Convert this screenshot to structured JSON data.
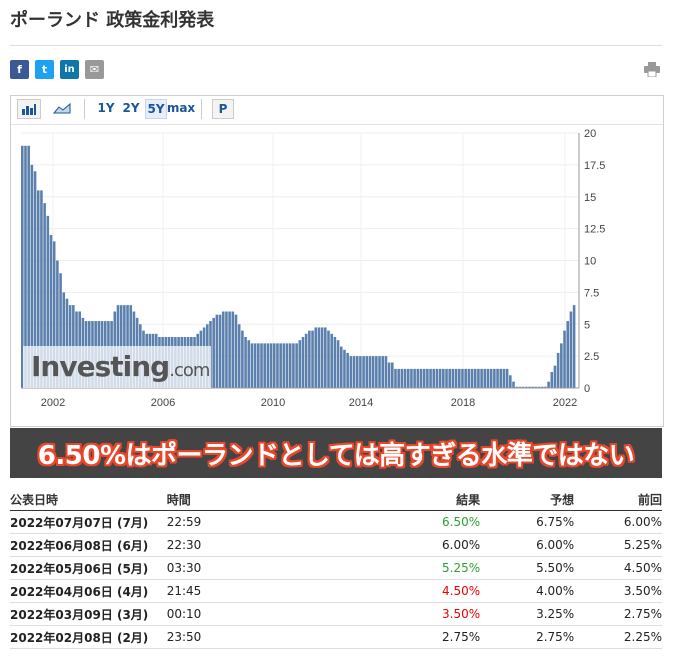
{
  "page": {
    "title": "ポーランド 政策金利発表"
  },
  "share": {
    "facebook": "f",
    "twitter": "t",
    "linkedin": "in",
    "email": "✉"
  },
  "toolbar": {
    "ranges": [
      "1Y",
      "2Y",
      "5Y",
      "max"
    ],
    "active_range": "5Y",
    "p_button": "P"
  },
  "chart_data": {
    "type": "bar",
    "title": "",
    "x_ticks": [
      "2002",
      "2006",
      "2010",
      "2014",
      "2018",
      "2022"
    ],
    "y_ticks": [
      "20",
      "17.5",
      "15",
      "12.5",
      "10",
      "7.5",
      "5",
      "2.5",
      "0"
    ],
    "ylim": [
      0,
      20
    ],
    "grid": true,
    "watermark": "Investing",
    "watermark_suffix": ".com",
    "color": "#5b80ad",
    "values": [
      19,
      19,
      19,
      17.5,
      17,
      15.5,
      15.5,
      14.5,
      13.5,
      12,
      11.5,
      10,
      9,
      7.5,
      7,
      6.5,
      6.5,
      6,
      6,
      5.5,
      5.25,
      5.25,
      5.25,
      5.25,
      5.25,
      5.25,
      5.25,
      5.25,
      5.25,
      6,
      6.5,
      6.5,
      6.5,
      6.5,
      6.5,
      6,
      5.5,
      5,
      4.5,
      4.25,
      4.25,
      4.25,
      4.25,
      4,
      4,
      4,
      4,
      4,
      4,
      4,
      4,
      4,
      4,
      4,
      4,
      4.25,
      4.5,
      4.75,
      5,
      5.25,
      5.5,
      5.75,
      5.75,
      6,
      6,
      6,
      6,
      5.75,
      5,
      4.5,
      4,
      3.75,
      3.5,
      3.5,
      3.5,
      3.5,
      3.5,
      3.5,
      3.5,
      3.5,
      3.5,
      3.5,
      3.5,
      3.5,
      3.5,
      3.5,
      3.5,
      3.75,
      4,
      4.25,
      4.5,
      4.5,
      4.75,
      4.75,
      4.75,
      4.75,
      4.5,
      4.25,
      4,
      3.75,
      3.25,
      3,
      2.75,
      2.5,
      2.5,
      2.5,
      2.5,
      2.5,
      2.5,
      2.5,
      2.5,
      2.5,
      2.5,
      2.5,
      2.5,
      2,
      2,
      1.5,
      1.5,
      1.5,
      1.5,
      1.5,
      1.5,
      1.5,
      1.5,
      1.5,
      1.5,
      1.5,
      1.5,
      1.5,
      1.5,
      1.5,
      1.5,
      1.5,
      1.5,
      1.5,
      1.5,
      1.5,
      1.5,
      1.5,
      1.5,
      1.5,
      1.5,
      1.5,
      1.5,
      1.5,
      1.5,
      1.5,
      1.5,
      1.5,
      1.5,
      1.5,
      1.5,
      1,
      0.5,
      0.1,
      0.1,
      0.1,
      0.1,
      0.1,
      0.1,
      0.1,
      0.1,
      0.1,
      0.1,
      0.5,
      1.25,
      1.75,
      2.75,
      3.5,
      4.5,
      5.25,
      6,
      6.5
    ]
  },
  "banner": {
    "text": "6.50%はポーランドとしては高すぎる水準ではない"
  },
  "table": {
    "headers": [
      "公表日時",
      "時間",
      "結果",
      "予想",
      "前回"
    ],
    "rows": [
      {
        "date": "2022年07月07日 (7月)",
        "time": "22:59",
        "actual": "6.50%",
        "actual_color": "green",
        "forecast": "6.75%",
        "previous": "6.00%"
      },
      {
        "date": "2022年06月08日 (6月)",
        "time": "22:30",
        "actual": "6.00%",
        "actual_color": "black",
        "forecast": "6.00%",
        "previous": "5.25%"
      },
      {
        "date": "2022年05月06日 (5月)",
        "time": "03:30",
        "actual": "5.25%",
        "actual_color": "green",
        "forecast": "5.50%",
        "previous": "4.50%"
      },
      {
        "date": "2022年04月06日 (4月)",
        "time": "21:45",
        "actual": "4.50%",
        "actual_color": "red",
        "forecast": "4.00%",
        "previous": "3.50%"
      },
      {
        "date": "2022年03月09日 (3月)",
        "time": "00:10",
        "actual": "3.50%",
        "actual_color": "red",
        "forecast": "3.25%",
        "previous": "2.75%"
      },
      {
        "date": "2022年02月08日 (2月)",
        "time": "23:50",
        "actual": "2.75%",
        "actual_color": "black",
        "forecast": "2.75%",
        "previous": "2.25%"
      }
    ]
  }
}
